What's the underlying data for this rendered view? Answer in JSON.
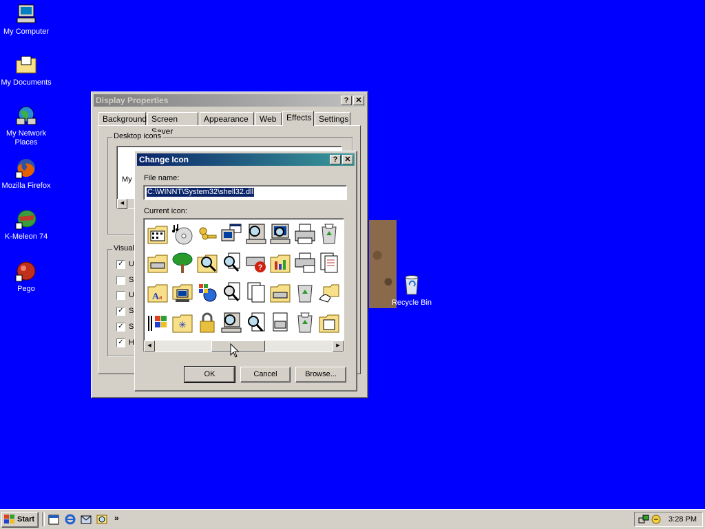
{
  "desktop": {
    "icons": [
      {
        "label": "My Computer",
        "icon": "computer-icon"
      },
      {
        "label": "My Documents",
        "icon": "folder-documents-icon"
      },
      {
        "label": "My Network Places",
        "icon": "network-icon"
      },
      {
        "label": "Mozilla Firefox",
        "icon": "firefox-icon"
      },
      {
        "label": "K-Meleon 74",
        "icon": "kmeleon-icon"
      },
      {
        "label": "Pego",
        "icon": "pego-icon"
      }
    ],
    "recycle_bin": "Recycle Bin",
    "background_color": "#0000fe"
  },
  "display_properties": {
    "title": "Display Properties",
    "tabs": [
      "Background",
      "Screen Saver",
      "Appearance",
      "Web",
      "Effects",
      "Settings"
    ],
    "active_tab": "Effects",
    "desktop_icons_group": "Desktop icons",
    "partial_icon_label": "My I",
    "visual_group": "Visual",
    "visual_options": [
      {
        "text": "U",
        "checked": true
      },
      {
        "text": "Sr",
        "checked": false
      },
      {
        "text": "U",
        "checked": false
      },
      {
        "text": "Sl",
        "checked": true
      },
      {
        "text": "Sl",
        "checked": true
      },
      {
        "text": "H",
        "checked": true
      }
    ]
  },
  "change_icon": {
    "title": "Change Icon",
    "file_name_label": "File name:",
    "file_name_value": "C:\\WINNT\\System32\\shell32.dll",
    "current_icon_label": "Current icon:",
    "ok": "OK",
    "cancel": "Cancel",
    "browse": "Browse..."
  },
  "taskbar": {
    "start": "Start",
    "chevron": "»",
    "clock": "3:28 PM",
    "quick_launch": [
      "calendar-icon",
      "ie-icon",
      "outlook-icon",
      "search-icon"
    ]
  },
  "colors": {
    "active_title": "#0a246a",
    "face": "#d4d0c8",
    "selection": "#0a246a"
  }
}
